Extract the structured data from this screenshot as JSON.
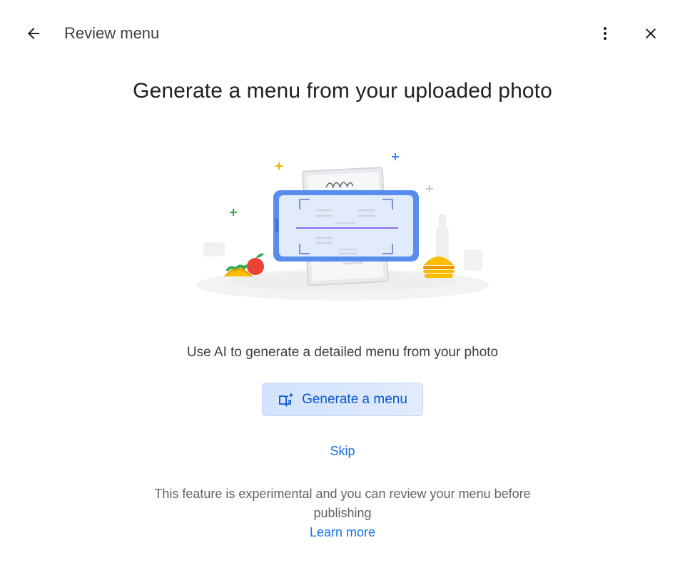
{
  "header": {
    "title": "Review menu",
    "back_icon": "arrow-back-icon",
    "more_icon": "more-vert-icon",
    "close_icon": "close-icon"
  },
  "main": {
    "title": "Generate a menu from your uploaded photo",
    "illustration": "menu-photo-scan-illustration",
    "description": "Use AI to generate a detailed menu from your photo",
    "generate_button": {
      "label": "Generate a menu",
      "icon": "menu-book-sparkle-icon"
    },
    "skip_label": "Skip",
    "note": "This feature is experimental and you can review your menu before publishing",
    "learn_more_label": "Learn more"
  },
  "colors": {
    "accent": "#1a73e8",
    "button_bg": "#d3e3fd",
    "button_text": "#0b57d0",
    "title_text": "#202124",
    "secondary_text": "#5f6368"
  }
}
